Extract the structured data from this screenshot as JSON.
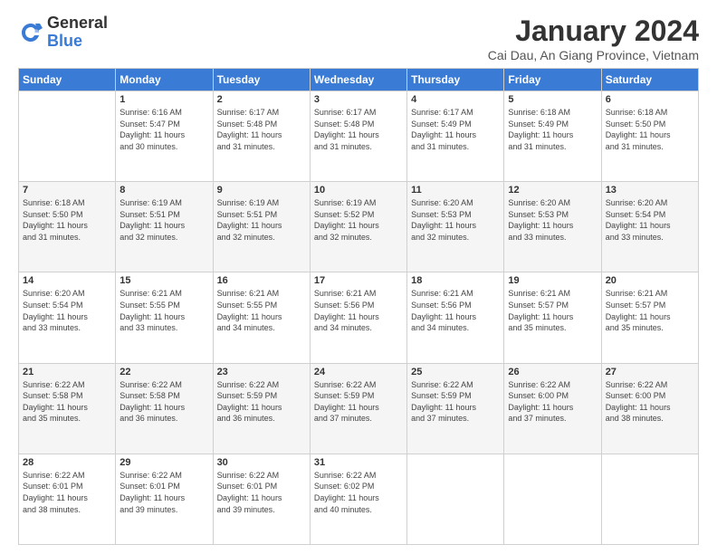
{
  "logo": {
    "general": "General",
    "blue": "Blue"
  },
  "header": {
    "title": "January 2024",
    "subtitle": "Cai Dau, An Giang Province, Vietnam"
  },
  "days_of_week": [
    "Sunday",
    "Monday",
    "Tuesday",
    "Wednesday",
    "Thursday",
    "Friday",
    "Saturday"
  ],
  "weeks": [
    [
      {
        "day": "",
        "info": ""
      },
      {
        "day": "1",
        "info": "Sunrise: 6:16 AM\nSunset: 5:47 PM\nDaylight: 11 hours\nand 30 minutes."
      },
      {
        "day": "2",
        "info": "Sunrise: 6:17 AM\nSunset: 5:48 PM\nDaylight: 11 hours\nand 31 minutes."
      },
      {
        "day": "3",
        "info": "Sunrise: 6:17 AM\nSunset: 5:48 PM\nDaylight: 11 hours\nand 31 minutes."
      },
      {
        "day": "4",
        "info": "Sunrise: 6:17 AM\nSunset: 5:49 PM\nDaylight: 11 hours\nand 31 minutes."
      },
      {
        "day": "5",
        "info": "Sunrise: 6:18 AM\nSunset: 5:49 PM\nDaylight: 11 hours\nand 31 minutes."
      },
      {
        "day": "6",
        "info": "Sunrise: 6:18 AM\nSunset: 5:50 PM\nDaylight: 11 hours\nand 31 minutes."
      }
    ],
    [
      {
        "day": "7",
        "info": "Sunrise: 6:18 AM\nSunset: 5:50 PM\nDaylight: 11 hours\nand 31 minutes."
      },
      {
        "day": "8",
        "info": "Sunrise: 6:19 AM\nSunset: 5:51 PM\nDaylight: 11 hours\nand 32 minutes."
      },
      {
        "day": "9",
        "info": "Sunrise: 6:19 AM\nSunset: 5:51 PM\nDaylight: 11 hours\nand 32 minutes."
      },
      {
        "day": "10",
        "info": "Sunrise: 6:19 AM\nSunset: 5:52 PM\nDaylight: 11 hours\nand 32 minutes."
      },
      {
        "day": "11",
        "info": "Sunrise: 6:20 AM\nSunset: 5:53 PM\nDaylight: 11 hours\nand 32 minutes."
      },
      {
        "day": "12",
        "info": "Sunrise: 6:20 AM\nSunset: 5:53 PM\nDaylight: 11 hours\nand 33 minutes."
      },
      {
        "day": "13",
        "info": "Sunrise: 6:20 AM\nSunset: 5:54 PM\nDaylight: 11 hours\nand 33 minutes."
      }
    ],
    [
      {
        "day": "14",
        "info": "Sunrise: 6:20 AM\nSunset: 5:54 PM\nDaylight: 11 hours\nand 33 minutes."
      },
      {
        "day": "15",
        "info": "Sunrise: 6:21 AM\nSunset: 5:55 PM\nDaylight: 11 hours\nand 33 minutes."
      },
      {
        "day": "16",
        "info": "Sunrise: 6:21 AM\nSunset: 5:55 PM\nDaylight: 11 hours\nand 34 minutes."
      },
      {
        "day": "17",
        "info": "Sunrise: 6:21 AM\nSunset: 5:56 PM\nDaylight: 11 hours\nand 34 minutes."
      },
      {
        "day": "18",
        "info": "Sunrise: 6:21 AM\nSunset: 5:56 PM\nDaylight: 11 hours\nand 34 minutes."
      },
      {
        "day": "19",
        "info": "Sunrise: 6:21 AM\nSunset: 5:57 PM\nDaylight: 11 hours\nand 35 minutes."
      },
      {
        "day": "20",
        "info": "Sunrise: 6:21 AM\nSunset: 5:57 PM\nDaylight: 11 hours\nand 35 minutes."
      }
    ],
    [
      {
        "day": "21",
        "info": "Sunrise: 6:22 AM\nSunset: 5:58 PM\nDaylight: 11 hours\nand 35 minutes."
      },
      {
        "day": "22",
        "info": "Sunrise: 6:22 AM\nSunset: 5:58 PM\nDaylight: 11 hours\nand 36 minutes."
      },
      {
        "day": "23",
        "info": "Sunrise: 6:22 AM\nSunset: 5:59 PM\nDaylight: 11 hours\nand 36 minutes."
      },
      {
        "day": "24",
        "info": "Sunrise: 6:22 AM\nSunset: 5:59 PM\nDaylight: 11 hours\nand 37 minutes."
      },
      {
        "day": "25",
        "info": "Sunrise: 6:22 AM\nSunset: 5:59 PM\nDaylight: 11 hours\nand 37 minutes."
      },
      {
        "day": "26",
        "info": "Sunrise: 6:22 AM\nSunset: 6:00 PM\nDaylight: 11 hours\nand 37 minutes."
      },
      {
        "day": "27",
        "info": "Sunrise: 6:22 AM\nSunset: 6:00 PM\nDaylight: 11 hours\nand 38 minutes."
      }
    ],
    [
      {
        "day": "28",
        "info": "Sunrise: 6:22 AM\nSunset: 6:01 PM\nDaylight: 11 hours\nand 38 minutes."
      },
      {
        "day": "29",
        "info": "Sunrise: 6:22 AM\nSunset: 6:01 PM\nDaylight: 11 hours\nand 39 minutes."
      },
      {
        "day": "30",
        "info": "Sunrise: 6:22 AM\nSunset: 6:01 PM\nDaylight: 11 hours\nand 39 minutes."
      },
      {
        "day": "31",
        "info": "Sunrise: 6:22 AM\nSunset: 6:02 PM\nDaylight: 11 hours\nand 40 minutes."
      },
      {
        "day": "",
        "info": ""
      },
      {
        "day": "",
        "info": ""
      },
      {
        "day": "",
        "info": ""
      }
    ]
  ]
}
